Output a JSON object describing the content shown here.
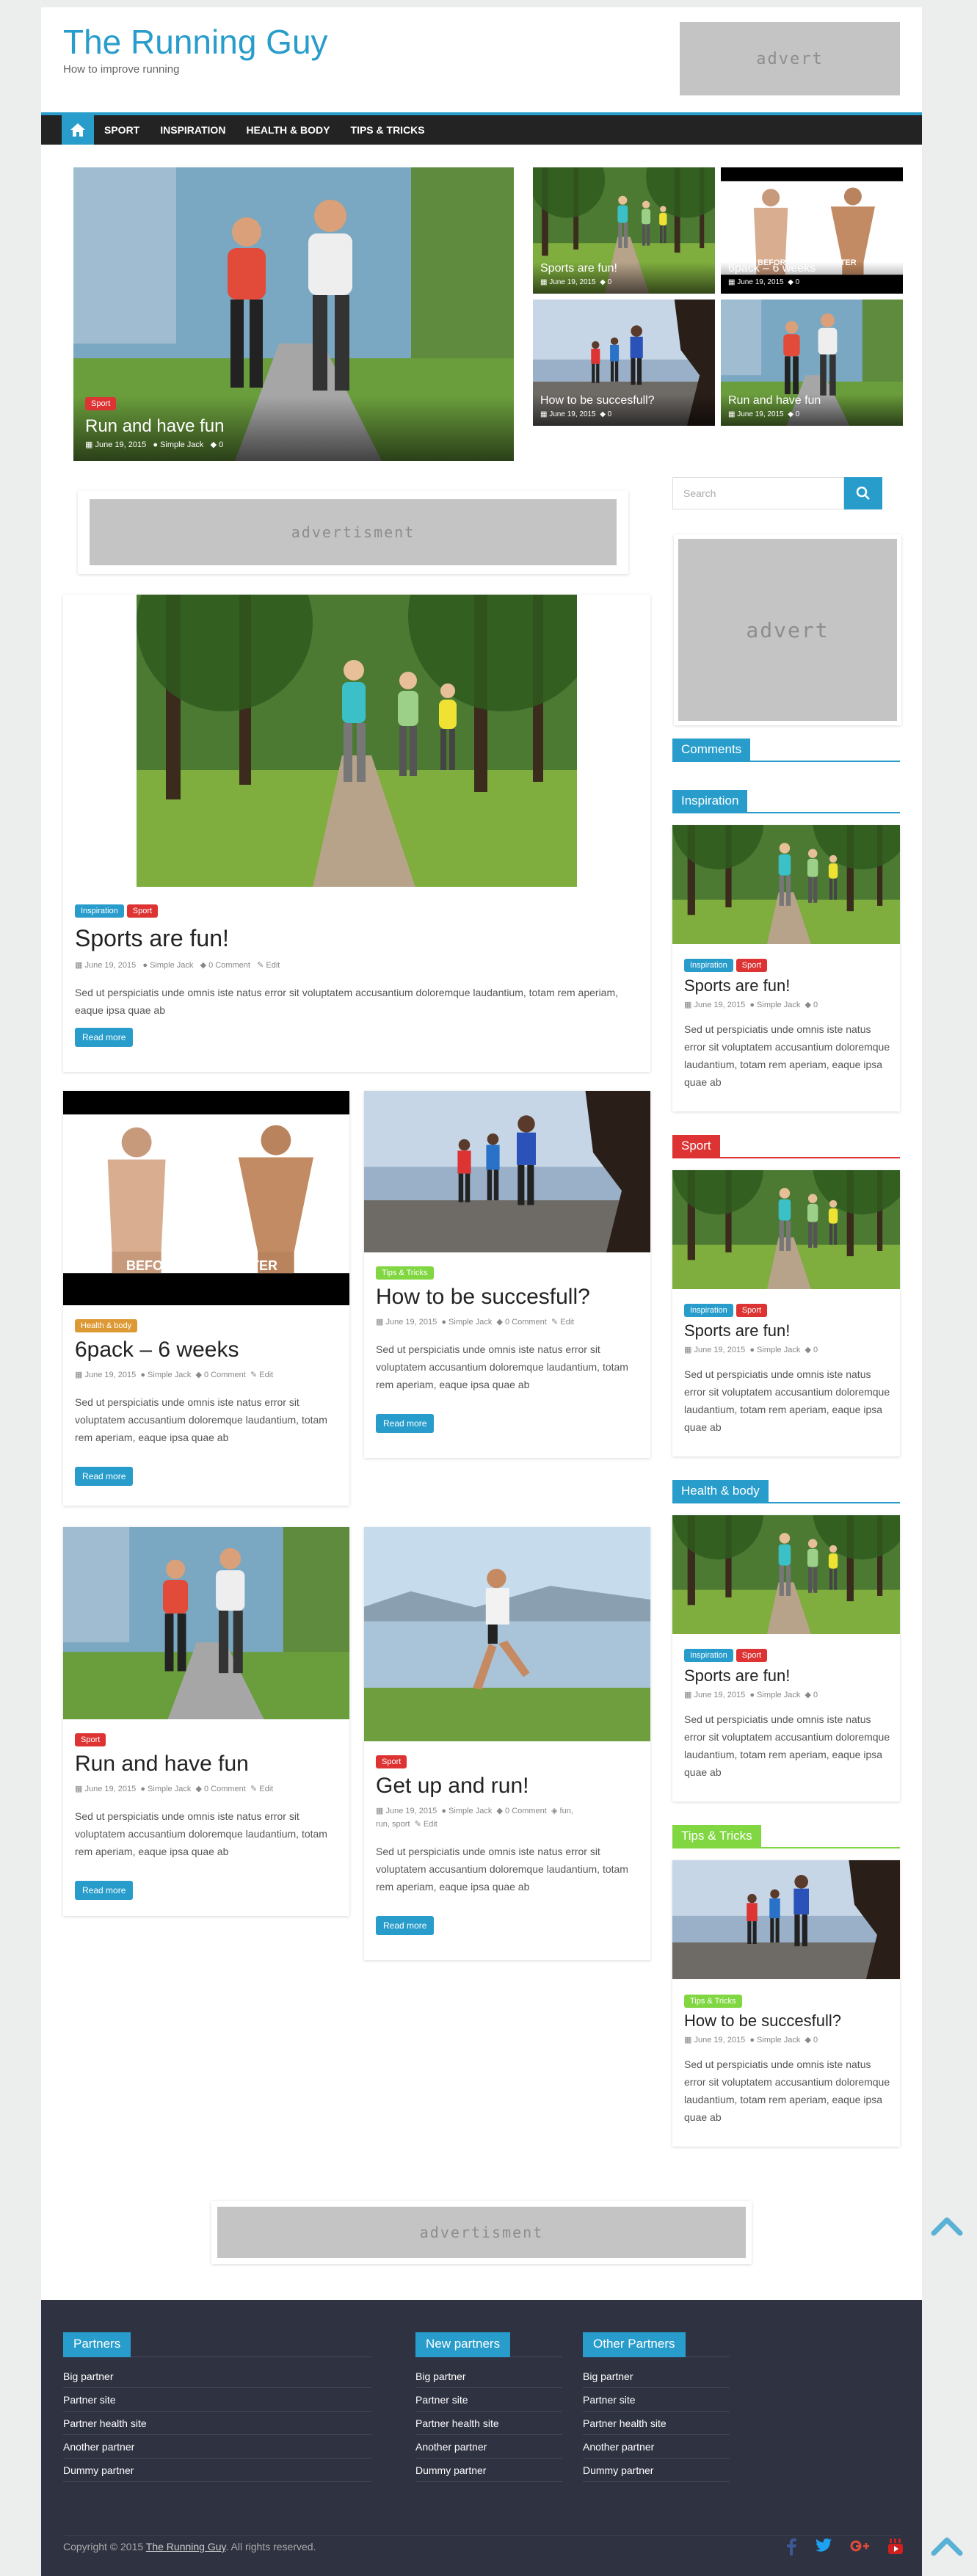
{
  "site": {
    "title": "The Running Guy",
    "description": "How to improve running"
  },
  "ads": {
    "header": "advert",
    "content": "advertisment",
    "sidebar": "advert",
    "bottom": "advertisment"
  },
  "nav": {
    "home_icon": "home-icon",
    "items": [
      "SPORT",
      "INSPIRATION",
      "HEALTH & BODY",
      "TIPS & TRICKS"
    ]
  },
  "slider": {
    "main": {
      "tag": "Sport",
      "title": "Run and have fun",
      "date": "June 19, 2015",
      "author": "Simple Jack",
      "comments": "0"
    },
    "small": [
      {
        "title": "Sports are fun!",
        "date": "June 19, 2015",
        "comments": "0"
      },
      {
        "title": "6pack – 6 weeks",
        "date": "June 19, 2015",
        "comments": "0"
      },
      {
        "title": "How to be succesfull?",
        "date": "June 19, 2015",
        "comments": "0"
      },
      {
        "title": "Run and have fun",
        "date": "June 19, 2015",
        "comments": "0"
      }
    ]
  },
  "before_after": {
    "before": "BEFORE",
    "after": "AFTER"
  },
  "search": {
    "placeholder": "Search"
  },
  "excerpt": "Sed ut perspiciatis unde omnis iste natus error sit voluptatem accusantium doloremque laudantium, totam rem aperiam, eaque ipsa quae ab",
  "read_more": "Read more",
  "posts": {
    "featured": {
      "tags": [
        "Inspiration",
        "Sport"
      ],
      "title": "Sports are fun!",
      "date": "June 19, 2015",
      "author": "Simple Jack",
      "comments": "0 Comment",
      "edit": "Edit"
    },
    "p1": {
      "tag": "Health & body",
      "title": "6pack – 6 weeks",
      "date": "June 19, 2015",
      "author": "Simple Jack",
      "comments": "0 Comment",
      "edit": "Edit"
    },
    "p2": {
      "tag": "Tips & Tricks",
      "title": "How to be succesfull?",
      "date": "June 19, 2015",
      "author": "Simple Jack",
      "comments": "0 Comment",
      "edit": "Edit"
    },
    "p3": {
      "tag": "Sport",
      "title": "Run and have fun",
      "date": "June 19, 2015",
      "author": "Simple Jack",
      "comments": "0 Comment",
      "edit": "Edit"
    },
    "p4": {
      "tag": "Sport",
      "title": "Get up and run!",
      "date": "June 19, 2015",
      "author": "Simple Jack",
      "comments": "0 Comment",
      "tags_line1": "fun,",
      "tags_line2": "run, sport",
      "edit": "Edit"
    }
  },
  "sidebar": {
    "comments_title": "Comments",
    "widgets": [
      {
        "title": "Inspiration",
        "color": "#289dcc",
        "tags": [
          "Inspiration",
          "Sport"
        ],
        "post_title": "Sports are fun!",
        "date": "June 19, 2015",
        "author": "Simple Jack",
        "comments": "0"
      },
      {
        "title": "Sport",
        "color": "#dd3333",
        "tags": [
          "Inspiration",
          "Sport"
        ],
        "post_title": "Sports are fun!",
        "date": "June 19, 2015",
        "author": "Simple Jack",
        "comments": "0"
      },
      {
        "title": "Health & body",
        "color": "#289dcc",
        "tags": [
          "Inspiration",
          "Sport"
        ],
        "post_title": "Sports are fun!",
        "date": "June 19, 2015",
        "author": "Simple Jack",
        "comments": "0"
      },
      {
        "title": "Tips & Tricks",
        "color": "#81d742",
        "tags": [
          "Tips & Tricks"
        ],
        "post_title": "How to be succesfull?",
        "date": "June 19, 2015",
        "author": "Simple Jack",
        "comments": "0"
      }
    ]
  },
  "footer": {
    "columns": [
      {
        "title": "Partners",
        "links": [
          "Big partner",
          "Partner site",
          "Partner health site",
          "Another partner",
          "Dummy partner"
        ]
      },
      {
        "title": "New partners",
        "links": [
          "Big partner",
          "Partner site",
          "Partner health site",
          "Another partner",
          "Dummy partner"
        ]
      },
      {
        "title": "Other Partners",
        "links": [
          "Big partner",
          "Partner site",
          "Partner health site",
          "Another partner",
          "Dummy partner"
        ]
      }
    ],
    "copyright_prefix": "Copyright © 2015 ",
    "copyright_link": "The Running Guy",
    "copyright_suffix": ". All rights reserved.",
    "social": [
      "facebook-icon",
      "twitter-icon",
      "google-plus-icon",
      "youtube-icon"
    ]
  },
  "colors": {
    "accent": "#289dcc",
    "sport": "#dd3333",
    "tips": "#81d742",
    "health": "#dd9933",
    "footer": "#2f3241"
  }
}
